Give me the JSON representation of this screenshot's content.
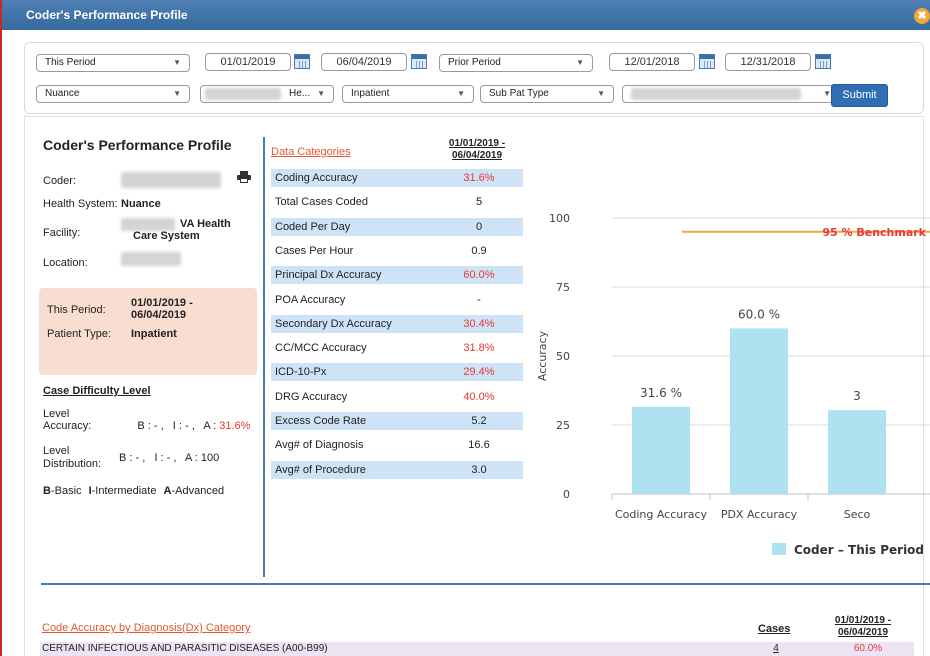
{
  "window": {
    "title": "Coder's Performance Profile",
    "close_glyph": "✖"
  },
  "filters": {
    "period_select": "This Period",
    "start_date": "01/01/2019",
    "end_date": "06/04/2019",
    "prior_select": "Prior Period",
    "prior_start": "12/01/2018",
    "prior_end": "12/31/2018",
    "vendor_select": "Nuance",
    "health_select": "He...",
    "patient_type_select": "Inpatient",
    "sub_pat_type_select": "Sub Pat Type",
    "submit_label": "Submit"
  },
  "profile": {
    "heading": "Coder's Performance Profile",
    "coder_label": "Coder:",
    "health_system_label": "Health System:",
    "health_system_value": "Nuance",
    "facility_label": "Facility:",
    "facility_value_1": "VA Health",
    "facility_value_2": "Care System",
    "location_label": "Location:",
    "period_label": "This Period:",
    "period_value_1": "01/01/2019 -",
    "period_value_2": "06/04/2019",
    "patient_type_label": "Patient Type:",
    "patient_type_value": "Inpatient",
    "difficulty_title": "Case Difficulty Level",
    "level_accuracy_label_1": "Level",
    "level_accuracy_label_2": "Accuracy:",
    "level_accuracy_prefix": "B : - ,   I : - ,   A : ",
    "level_accuracy_value": "31.6%",
    "level_distribution_label_1": "Level",
    "level_distribution_label_2": "Distribution:",
    "level_distribution_value": "B : - ,   I : - ,   A : 100",
    "legend_b": "B",
    "legend_b_text": "-Basic",
    "legend_i": "I",
    "legend_i_text": "-Intermediate",
    "legend_a": "A",
    "legend_a_text": "-Advanced"
  },
  "categories": {
    "heading": "Data Categories",
    "date_line_1": "01/01/2019 -",
    "date_line_2": "06/04/2019",
    "rows": [
      {
        "name": "Coding Accuracy",
        "value": "31.6%",
        "red": true
      },
      {
        "name": "Total Cases Coded",
        "value": "5",
        "red": false
      },
      {
        "name": "Coded Per Day",
        "value": "0",
        "red": false
      },
      {
        "name": "Cases Per Hour",
        "value": "0.9",
        "red": false
      },
      {
        "name": "Principal Dx Accuracy",
        "value": "60.0%",
        "red": true
      },
      {
        "name": "POA Accuracy",
        "value": "-",
        "red": false
      },
      {
        "name": "Secondary Dx Accuracy",
        "value": "30.4%",
        "red": true
      },
      {
        "name": "CC/MCC Accuracy",
        "value": "31.8%",
        "red": true
      },
      {
        "name": "ICD-10-Px",
        "value": "29.4%",
        "red": true
      },
      {
        "name": "DRG Accuracy",
        "value": "40.0%",
        "red": true
      },
      {
        "name": "Excess Code Rate",
        "value": "5.2",
        "red": false
      },
      {
        "name": "Avg# of Diagnosis",
        "value": "16.6",
        "red": false
      },
      {
        "name": "Avg# of Procedure",
        "value": "3.0",
        "red": false
      }
    ]
  },
  "chart_data": {
    "type": "bar",
    "categories": [
      "Coding Accuracy",
      "PDX Accuracy",
      "Seco"
    ],
    "series": [
      {
        "name": "Coder – This Period",
        "values": [
          31.6,
          60.0,
          30.4
        ],
        "labels": [
          "31.6 %",
          "60.0 %",
          "3"
        ],
        "color": "#aee2f0"
      }
    ],
    "ylabel": "Accuracy",
    "ylim": [
      0,
      100
    ],
    "yticks": [
      "0",
      "25",
      "50",
      "75",
      "100"
    ],
    "benchmark": {
      "value": 95,
      "label": "95 % Benchmark",
      "color": "#f3a73b",
      "label_color": "#e53935"
    },
    "legend_position": "bottom"
  },
  "dx_table": {
    "heading": "Code Accuracy by Diagnosis(Dx) Category",
    "cases_heading": "Cases",
    "date_line_1": "01/01/2019 -",
    "date_line_2": "06/04/2019",
    "rows": [
      {
        "name": "CERTAIN INFECTIOUS AND PARASITIC DISEASES (A00-B99)",
        "cases": "4",
        "pct": "60.0%"
      }
    ]
  }
}
